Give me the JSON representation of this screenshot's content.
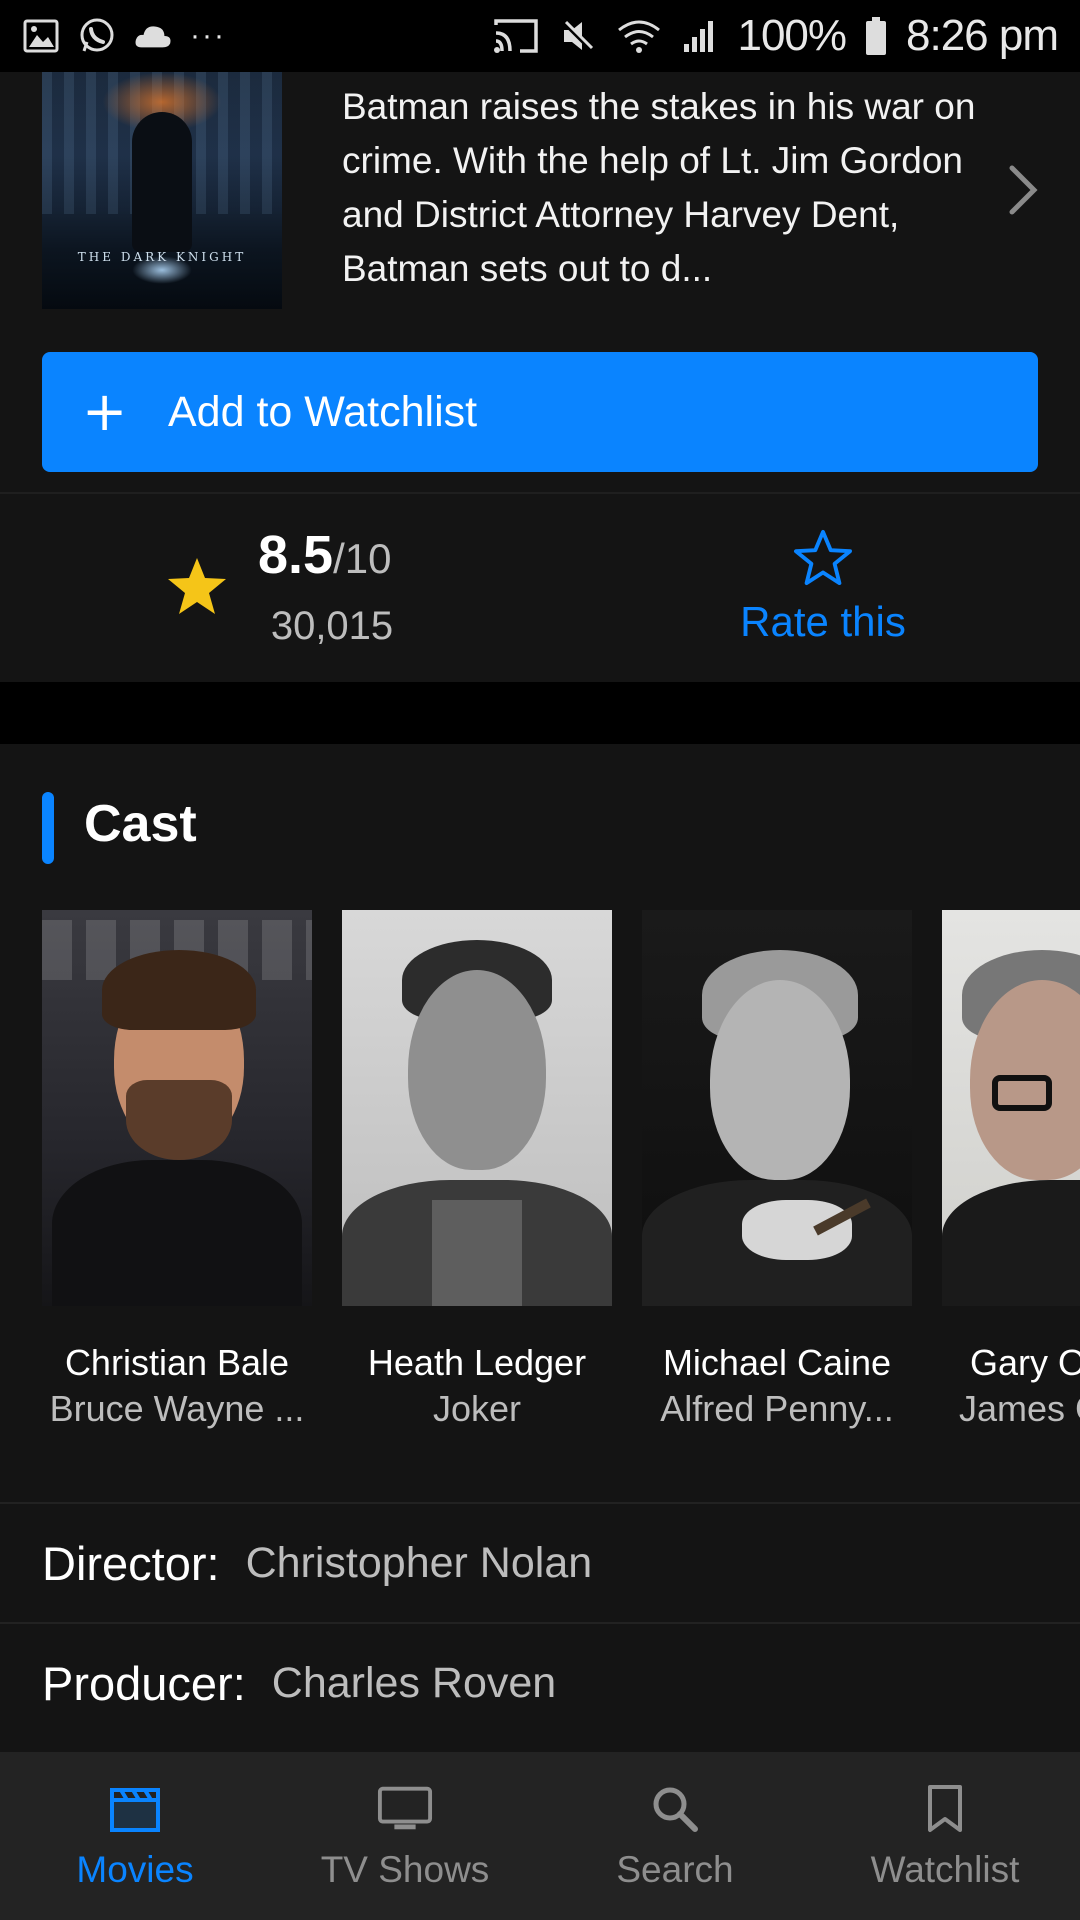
{
  "status_bar": {
    "battery": "100%",
    "time": "8:26 pm",
    "more": "···"
  },
  "overview": {
    "poster_title": "THE DARK KNIGHT",
    "plot": "Batman raises the stakes in his war on crime. With the help of Lt. Jim Gordon and District Attorney Harvey Dent, Batman sets out to d..."
  },
  "watchlist_button": {
    "icon": "+",
    "label": "Add to Watchlist"
  },
  "rating": {
    "score": "8.5",
    "scale": "/10",
    "votes": "30,015",
    "rate_label": "Rate this"
  },
  "cast": {
    "title": "Cast",
    "members": [
      {
        "name": "Christian Bale",
        "role": "Bruce Wayne ..."
      },
      {
        "name": "Heath Ledger",
        "role": "Joker"
      },
      {
        "name": "Michael Caine",
        "role": "Alfred Penny..."
      },
      {
        "name": "Gary Oldman",
        "role": "James Gordon"
      }
    ]
  },
  "crew": {
    "director_label": "Director:",
    "director": "Christopher Nolan",
    "producer_label": "Producer:",
    "producer": "Charles Roven"
  },
  "nav": {
    "items": [
      {
        "label": "Movies",
        "icon": "clapperboard-icon",
        "active": true
      },
      {
        "label": "TV Shows",
        "icon": "tv-icon",
        "active": false
      },
      {
        "label": "Search",
        "icon": "search-icon",
        "active": false
      },
      {
        "label": "Watchlist",
        "icon": "bookmark-icon",
        "active": false
      }
    ]
  },
  "colors": {
    "accent": "#0a84ff",
    "star": "#f5c518",
    "background": "#141414"
  }
}
